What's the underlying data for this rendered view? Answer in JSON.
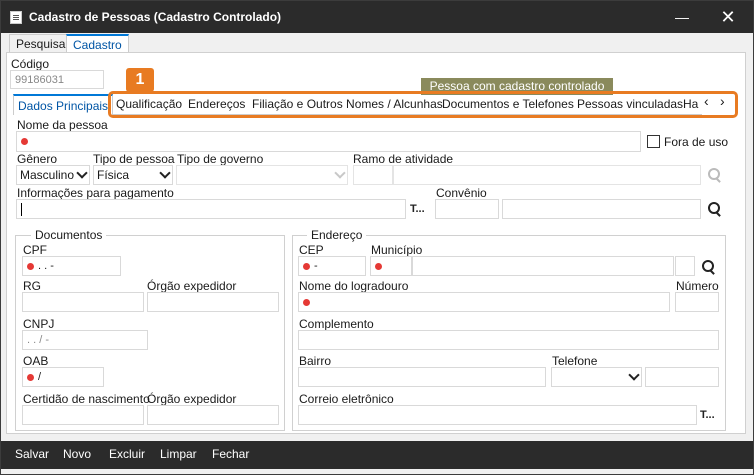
{
  "window": {
    "title": "Cadastro de Pessoas (Cadastro Controlado)"
  },
  "icons": {
    "minimize": "minimize-icon",
    "close": "close-icon",
    "search": "search-icon"
  },
  "colors": {
    "titlebar": "#2b2b2b",
    "accent": "#0078d7",
    "highlight": "#e87b22",
    "required": "#e53935",
    "controlled_badge": "#8a8a5c"
  },
  "top_tabs": [
    {
      "label": "Pesquisa"
    },
    {
      "label": "Cadastro"
    }
  ],
  "codigo": {
    "label": "Código",
    "value": "99186031"
  },
  "controlled_badge": "Pessoa com cadastro controlado",
  "callout": "1",
  "inner_tabs": [
    {
      "label": "Dados Principais"
    },
    {
      "label": "Qualificação"
    },
    {
      "label": "Endereços"
    },
    {
      "label": "Filiação e Outros Nomes / Alcunhas"
    },
    {
      "label": "Documentos e Telefones"
    },
    {
      "label": "Pessoas vinculadas"
    },
    {
      "label": "Ha"
    }
  ],
  "nav_arrows": {
    "prev": "‹",
    "next": "›"
  },
  "form": {
    "nome_label": "Nome da pessoa",
    "fora_de_uso": "Fora de uso",
    "genero_label": "Gênero",
    "genero_value": "Masculino",
    "tipo_pessoa_label": "Tipo de pessoa",
    "tipo_pessoa_value": "Física",
    "tipo_governo_label": "Tipo de governo",
    "ramo_label": "Ramo de atividade",
    "info_pagamento_label": "Informações para pagamento",
    "info_pagamento_btn": "T...",
    "convenio_label": "Convênio"
  },
  "documentos": {
    "title": "Documentos",
    "cpf_label": "CPF",
    "cpf_value": ".  .  -",
    "rg_label": "RG",
    "orgao_label": "Órgão expedidor",
    "cnpj_label": "CNPJ",
    "cnpj_value": ".  .  /  -",
    "oab_label": "OAB",
    "oab_value": "/",
    "certidao_label": "Certidão de nascimento",
    "orgao2_label": "Órgão expedidor"
  },
  "endereco": {
    "title": "Endereço",
    "cep_label": "CEP",
    "cep_value": "-",
    "municipio_label": "Município",
    "logradouro_label": "Nome do logradouro",
    "numero_label": "Número",
    "complemento_label": "Complemento",
    "bairro_label": "Bairro",
    "telefone_label": "Telefone",
    "email_label": "Correio eletrônico",
    "email_btn": "T..."
  },
  "footer": [
    {
      "label": "Salvar"
    },
    {
      "label": "Novo"
    },
    {
      "label": "Excluir"
    },
    {
      "label": "Limpar"
    },
    {
      "label": "Fechar"
    }
  ]
}
